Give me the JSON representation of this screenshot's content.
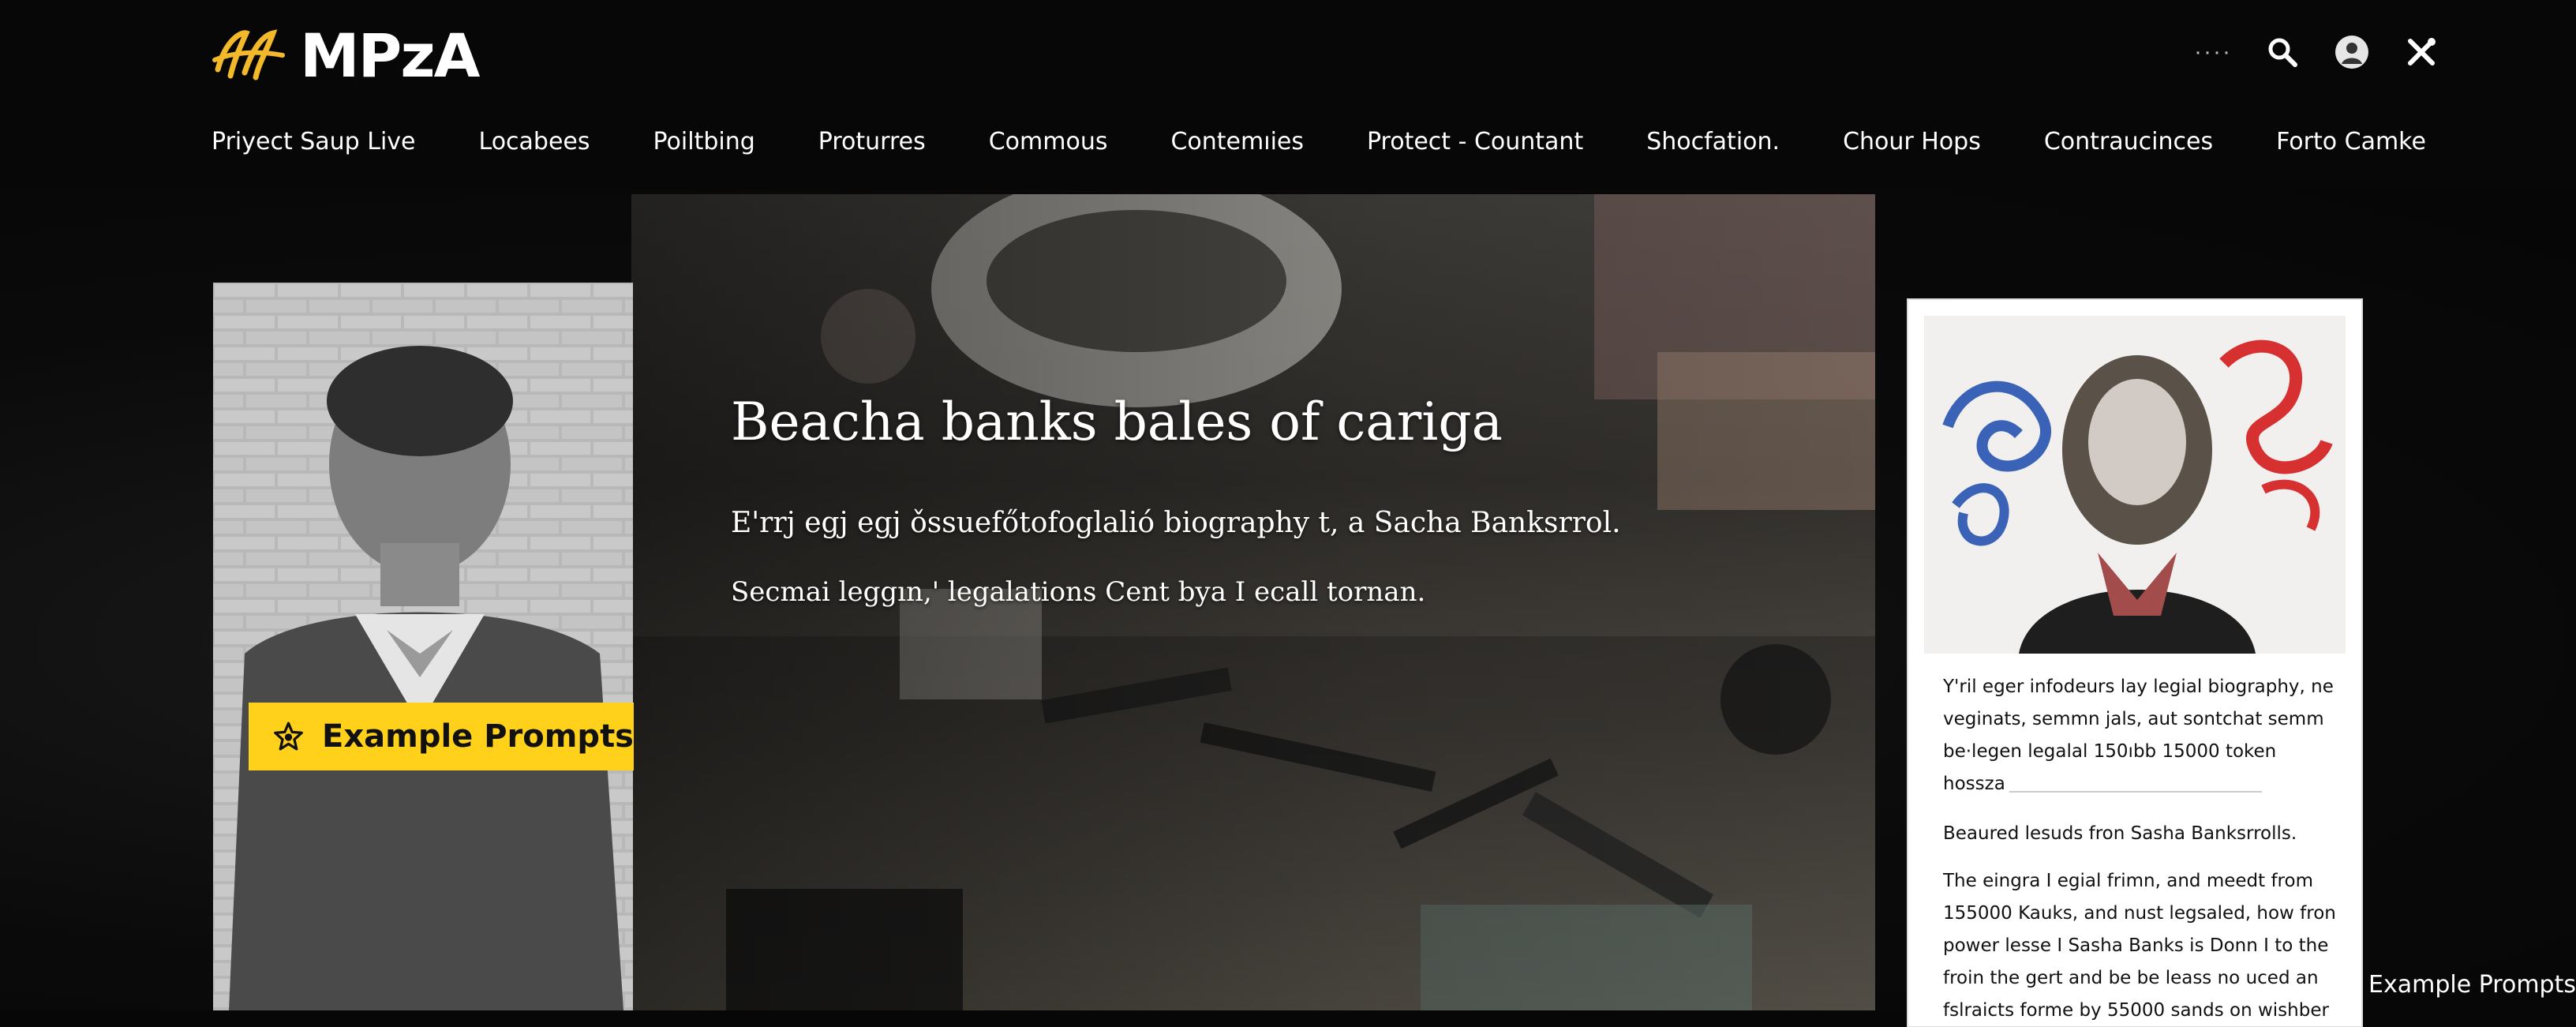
{
  "brand": {
    "name": "MPzA"
  },
  "header": {
    "icons": [
      "more-dots-icon",
      "search-icon",
      "user-avatar-icon",
      "tools-icon"
    ],
    "more_dots": "····"
  },
  "nav": {
    "items": [
      "Priyect Saup Live",
      "Locabees",
      "Poiltbing",
      "Proturres",
      "Commous",
      "Contemıies",
      "Protect - Countant",
      "Shocfation.",
      "Chour Hops",
      "Contraucinces",
      "Forto Camke"
    ]
  },
  "hero": {
    "title": "Beacha banks bales of cariga",
    "subtitle": "E'rrj egj egj ǒssuefőtofoglalió biography t, a Sacha Banksrrol.",
    "tagline": "Secmai leggın,' legalations Cent bya I ecall tornan."
  },
  "prompt_button": {
    "label": "Example Prompts",
    "icon": "star-icon"
  },
  "card": {
    "intro_lines": [
      "Y'ril eger infodeurs  lay legial biography, ne",
      "veginats, semmn jals, aut sontchat semm",
      "be·legen legalal 150ıbb 15000 token hossza"
    ],
    "heading": "Beaured lesuds fron Sasha Banksrrolls.",
    "body_lines": [
      "The eingra I egial frimn, and meedt from",
      "155000 Kauks, and nust legsaled, how fron",
      "power lesse I Sasha Banks is Donn I to the",
      "froin the gert and be be leass no uced an",
      "fslraicts forme by 55000 sands on wishber"
    ]
  },
  "corner_label": "Example Prompts",
  "colors": {
    "accent": "#ffd11a",
    "background": "#070707",
    "card": "#ffffff"
  }
}
